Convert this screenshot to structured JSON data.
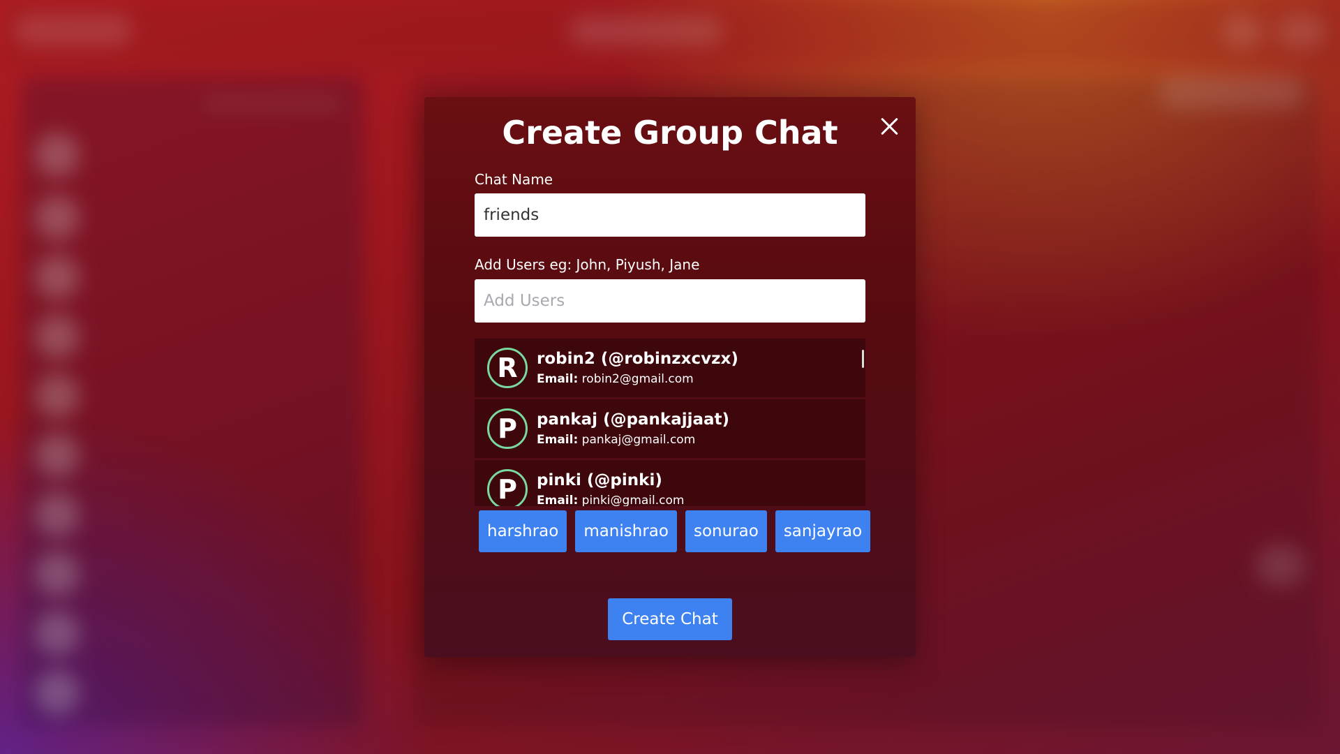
{
  "modal": {
    "title": "Create Group Chat",
    "chat_name_label": "Chat Name",
    "chat_name_value": "friends",
    "add_users_label": "Add Users eg: John, Piyush, Jane",
    "add_users_placeholder": "Add Users",
    "results": [
      {
        "initial": "R",
        "name": "robin2 (@robinzxcvzx)",
        "email_label": "Email:",
        "email": "robin2@gmail.com"
      },
      {
        "initial": "P",
        "name": "pankaj (@pankajjaat)",
        "email_label": "Email:",
        "email": "pankaj@gmail.com"
      },
      {
        "initial": "P",
        "name": "pinki (@pinki)",
        "email_label": "Email:",
        "email": "pinki@gmail.com"
      }
    ],
    "selected_users": [
      "harshrao",
      "manishrao",
      "sonurao",
      "sanjayrao"
    ],
    "create_button": "Create Chat"
  },
  "colors": {
    "accent": "#3d82f0",
    "avatar_border": "#7ad9a0",
    "modal_background": "#560b10"
  },
  "icons": {
    "close": "close-icon"
  }
}
